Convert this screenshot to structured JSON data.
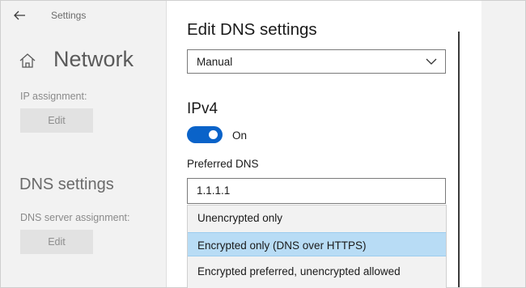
{
  "window": {
    "title": "Settings"
  },
  "left": {
    "page_title": "Network",
    "ip_assignment_label": "IP assignment:",
    "ip_edit_label": "Edit",
    "dns_heading": "DNS settings",
    "dns_assignment_label": "DNS server assignment:",
    "dns_edit_label": "Edit"
  },
  "dialog": {
    "title": "Edit DNS settings",
    "mode_select": {
      "selected": "Manual"
    },
    "ipv4_heading": "IPv4",
    "ipv4_toggle": {
      "state": "On",
      "on": true,
      "color": "#0a63c9"
    },
    "preferred_dns": {
      "label": "Preferred DNS",
      "value": "1.1.1.1"
    },
    "encryption_options": [
      {
        "label": "Unencrypted only",
        "selected": false
      },
      {
        "label": "Encrypted only (DNS over HTTPS)",
        "selected": true
      },
      {
        "label": "Encrypted preferred, unencrypted allowed",
        "selected": false
      }
    ]
  },
  "colors": {
    "accent": "#0a63c9",
    "selection": "#b8dcf5"
  },
  "icons": {
    "back": "arrow-left-icon",
    "home": "home-icon",
    "chevron": "chevron-down-icon"
  }
}
